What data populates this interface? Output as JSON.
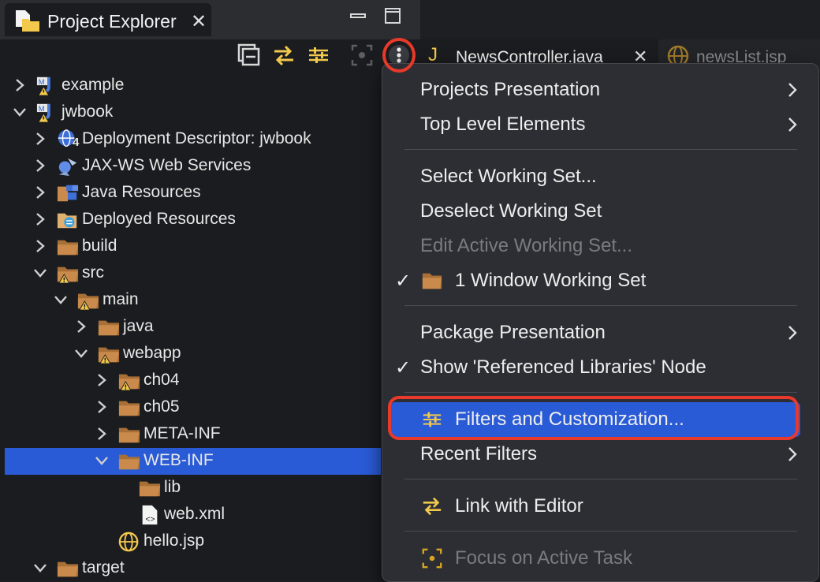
{
  "view": {
    "title": "Project Explorer",
    "close_glyph": "✕"
  },
  "toolbar": {
    "buttons": [
      "collapse-all-icon",
      "link-with-editor-icon",
      "filters-icon",
      "focus-icon",
      "view-menu-icon"
    ]
  },
  "editor_tabs": [
    {
      "label": "NewsController.java",
      "close": "✕"
    },
    {
      "label": "newsList.jsp"
    }
  ],
  "tree": [
    {
      "label": "example",
      "icon": "maven-project-icon",
      "expanded": false
    },
    {
      "label": "jwbook",
      "icon": "maven-project-icon",
      "expanded": true
    },
    {
      "label": "Deployment Descriptor: jwbook",
      "icon": "deployment-descriptor-icon",
      "badge": "4",
      "expanded": false
    },
    {
      "label": "JAX-WS Web Services",
      "icon": "web-services-icon",
      "expanded": false
    },
    {
      "label": "Java Resources",
      "icon": "java-resources-icon",
      "expanded": false
    },
    {
      "label": "Deployed Resources",
      "icon": "deployed-resources-icon",
      "expanded": false
    },
    {
      "label": "build",
      "icon": "folder-icon",
      "expanded": false
    },
    {
      "label": "src",
      "icon": "folder-warning-icon",
      "expanded": true
    },
    {
      "label": "main",
      "icon": "folder-warning-icon",
      "expanded": true
    },
    {
      "label": "java",
      "icon": "folder-icon",
      "expanded": false
    },
    {
      "label": "webapp",
      "icon": "folder-warning-icon",
      "expanded": true
    },
    {
      "label": "ch04",
      "icon": "folder-warning-icon",
      "expanded": false
    },
    {
      "label": "ch05",
      "icon": "folder-icon",
      "expanded": false
    },
    {
      "label": "META-INF",
      "icon": "folder-icon",
      "expanded": false
    },
    {
      "label": "WEB-INF",
      "icon": "folder-icon",
      "expanded": true,
      "selected": true
    },
    {
      "label": "lib",
      "icon": "folder-icon"
    },
    {
      "label": "web.xml",
      "icon": "xml-file-icon"
    },
    {
      "label": "hello.jsp",
      "icon": "jsp-file-icon"
    },
    {
      "label": "target",
      "icon": "folder-icon",
      "expanded": true
    }
  ],
  "menu": {
    "items": [
      {
        "label": "Projects Presentation",
        "submenu": true
      },
      {
        "label": "Top Level Elements",
        "submenu": true
      },
      {
        "label": "Select Working Set..."
      },
      {
        "label": "Deselect Working Set"
      },
      {
        "label": "Edit Active Working Set...",
        "disabled": true
      },
      {
        "label": "1 Window Working Set",
        "checked": true,
        "icon": "folder-icon"
      },
      {
        "label": "Package Presentation",
        "submenu": true
      },
      {
        "label": "Show 'Referenced Libraries' Node",
        "checked": true
      },
      {
        "label": "Filters and Customization...",
        "icon": "filters-icon",
        "highlighted": true
      },
      {
        "label": "Recent Filters",
        "submenu": true
      },
      {
        "label": "Link with Editor",
        "icon": "link-with-editor-icon"
      },
      {
        "label": "Focus on Active Task",
        "icon": "focus-icon",
        "disabled": true
      }
    ],
    "check_glyph": "✓"
  },
  "colors": {
    "accent": "#2a5bd6",
    "annotation_red": "#e8392a",
    "folder": "#c98a4b",
    "toolbar_yellow": "#f2c94c"
  }
}
